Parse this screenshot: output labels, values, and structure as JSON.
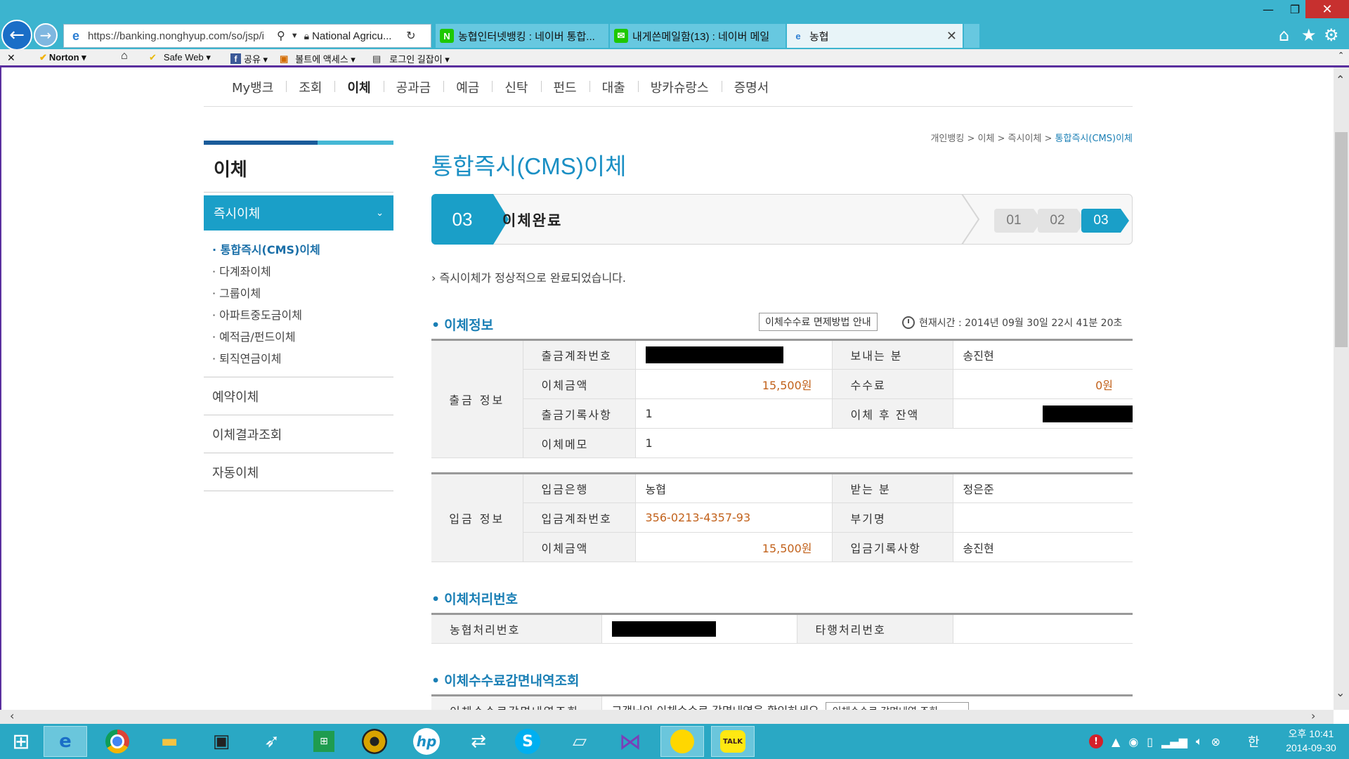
{
  "browser": {
    "address_url": "https://banking.nonghyup.com/so/jsp/i",
    "site_identity": "National Agricu...",
    "tabs": [
      {
        "label": "농협인터넷뱅킹 : 네이버 통합..."
      },
      {
        "label": "내게쓴메일함(13) : 네이버 메일"
      },
      {
        "label": "농협"
      }
    ],
    "toolbar": {
      "close": "✕",
      "norton": "Norton ▾",
      "safe_web": "Safe Web ▾",
      "share": "공유 ▾",
      "bolt": "볼트에 액세스 ▾",
      "login": "로그인 길잡이 ▾"
    }
  },
  "gnb": {
    "items": [
      "My뱅크",
      "조회",
      "이체",
      "공과금",
      "예금",
      "신탁",
      "펀드",
      "대출",
      "방카슈랑스",
      "증명서"
    ],
    "active": "이체"
  },
  "lnb": {
    "title": "이체",
    "active_section": "즉시이체",
    "sub_items": [
      "· 통합즉시(CMS)이체",
      "· 다계좌이체",
      "· 그룹이체",
      "· 아파트중도금이체",
      "· 예적금/펀드이체",
      "· 퇴직연금이체"
    ],
    "items": [
      "예약이체",
      "이체결과조회",
      "자동이체"
    ]
  },
  "breadcrumb": {
    "path": "개인뱅킹 > 이체 > 즉시이체 > ",
    "current": "통합즉시(CMS)이체"
  },
  "page_title": "통합즉시(CMS)이체",
  "steps": {
    "current_num": "03",
    "current_label": "이체완료",
    "pills": [
      "01",
      "02",
      "03"
    ]
  },
  "done_message": "› 즉시이체가 정상적으로 완료되었습니다.",
  "sections": {
    "transfer_info": "이체정보",
    "processing_number": "이체처리번호",
    "fee_waiver": "이체수수료감면내역조회"
  },
  "fee_guide_button": "이체수수료 면제방법 안내",
  "current_time": "현재시간 : 2014년 09월 30일 22시 41분 20초",
  "withdrawal": {
    "group": "출금 정보",
    "account_label": "출금계좌번호",
    "sender_label": "보내는 분",
    "sender": "송진현",
    "amount_label": "이체금액",
    "amount": "15,500원",
    "fee_label": "수수료",
    "fee": "0원",
    "record_label": "출금기록사항",
    "record": "1",
    "balance_label": "이체 후 잔액",
    "memo_label": "이체메모",
    "memo": "1"
  },
  "deposit": {
    "group": "입금 정보",
    "bank_label": "입금은행",
    "bank": "농협",
    "receiver_label": "받는 분",
    "receiver": "정은준",
    "account_label": "입금계좌번호",
    "account": "356-0213-4357-93",
    "sub_name_label": "부기명",
    "sub_name": "",
    "amount_label": "이체금액",
    "amount": "15,500원",
    "record_label": "입금기록사항",
    "record": "송진현"
  },
  "processing": {
    "nh_label": "농협처리번호",
    "other_label": "타행처리번호"
  },
  "fee_row": {
    "label": "이체수수료감면내역조회",
    "text": "고객님의 이체수수료 감면내역을 확인하세요",
    "button": "이체수수료 감면내역 조회"
  },
  "taskbar": {
    "ime": "한",
    "time": "오후 10:41",
    "date": "2014-09-30",
    "kakao_label": "TALK"
  },
  "colors": {
    "accent": "#1a9fc8",
    "title": "#1a8fc4",
    "amount": "#c2621c",
    "chrome": "#3cb4cf"
  }
}
